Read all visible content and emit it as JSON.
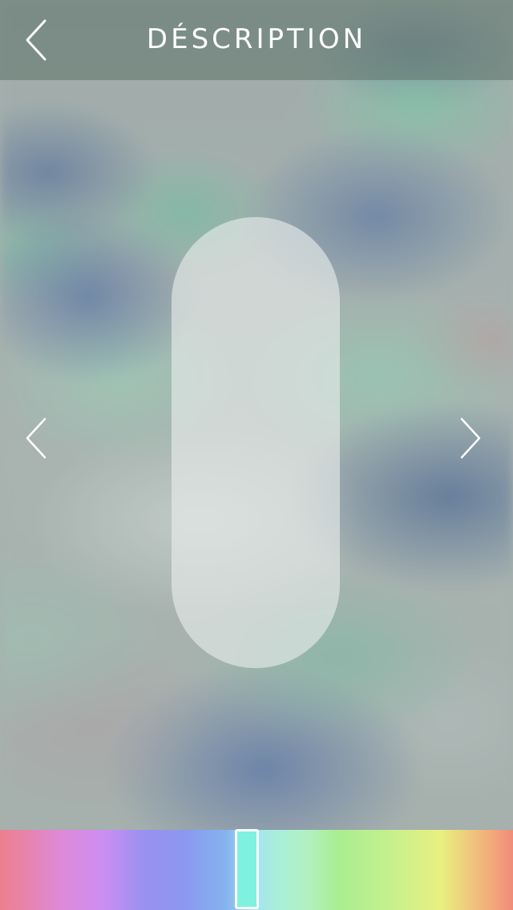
{
  "header": {
    "title": "DÉSCRIPTION",
    "back_icon": "chevron-left-icon"
  },
  "main": {
    "background": "blurred-pills-photo",
    "capsule_color": "#e8eeec",
    "prev_icon": "chevron-left-icon",
    "next_icon": "chevron-right-icon"
  },
  "color_picker": {
    "spectrum_colors": [
      "#ee7f8c",
      "#cc8ef2",
      "#8b98ef",
      "#a6e5ee",
      "#a9ee90",
      "#e9f080",
      "#f08c7a"
    ],
    "selected_color": "#7ef1df",
    "selected_position": 0.48
  }
}
